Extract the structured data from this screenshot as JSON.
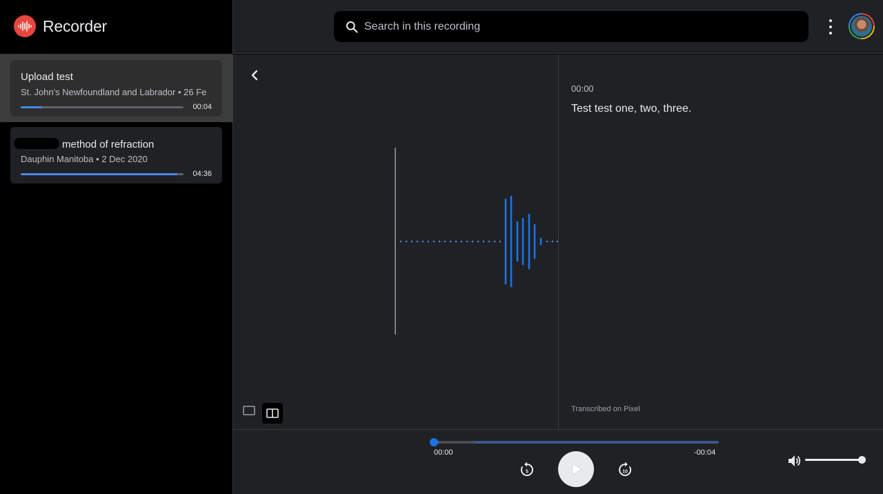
{
  "app": {
    "name": "Recorder",
    "brand_color": "#e8453c",
    "accent_color": "#1a73e8"
  },
  "search": {
    "placeholder": "Search in this recording"
  },
  "recordings": [
    {
      "title": "Upload test",
      "location": "St. John's Newfoundland and Labrador",
      "date": "26 Fe",
      "duration": "00:04",
      "progress": 0.13,
      "selected": true
    },
    {
      "title": "method of refraction",
      "title_prefix_redacted": true,
      "location": "Dauphin Manitoba",
      "date": "2 Dec 2020",
      "duration": "04:36",
      "progress": 0.96,
      "selected": false
    }
  ],
  "transcript": {
    "timestamp": "00:00",
    "text": "Test test one, two, three.",
    "footer": "Transcribed on Pixel"
  },
  "player": {
    "current_time": "00:00",
    "remaining_time": "-00:04",
    "position": 0,
    "volume": 1.0,
    "rewind_icon": "replay-5-icon",
    "forward_icon": "forward-10-icon"
  },
  "icons": {
    "search": "search-icon",
    "menu": "more-vert-icon",
    "back": "chevron-left-icon",
    "view_single": "single-pane-icon",
    "view_split": "split-pane-icon",
    "play": "play-icon",
    "volume": "volume-icon"
  }
}
